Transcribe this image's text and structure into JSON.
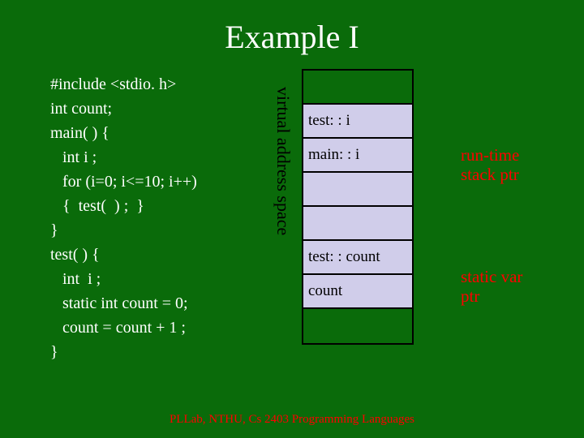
{
  "title": "Example I",
  "code": {
    "l0": "#include <stdio. h>",
    "l1": "int count;",
    "l2": "main( ) {",
    "l3": "   int i ;",
    "l4": "   for (i=0; i<=10; i++)",
    "l5": "   {  test(  ) ;  }",
    "l6": "}",
    "l7": "test( ) {",
    "l8": "   int  i ;",
    "l9": "   static int count = 0;",
    "l10": "   count = count + 1 ;",
    "l11": "}"
  },
  "vlabel": "virtual address space",
  "stack": {
    "c0": "",
    "c1": "test: : i",
    "c2": "main: : i",
    "c3": "",
    "c4": "",
    "c5": "test: : count",
    "c6": "count",
    "c7": ""
  },
  "annotations": {
    "runtime_l1": "run-time",
    "runtime_l2": "stack ptr",
    "static_l1": "static var",
    "static_l2": "ptr"
  },
  "footer": "PLLab, NTHU, Cs 2403 Programming Languages"
}
